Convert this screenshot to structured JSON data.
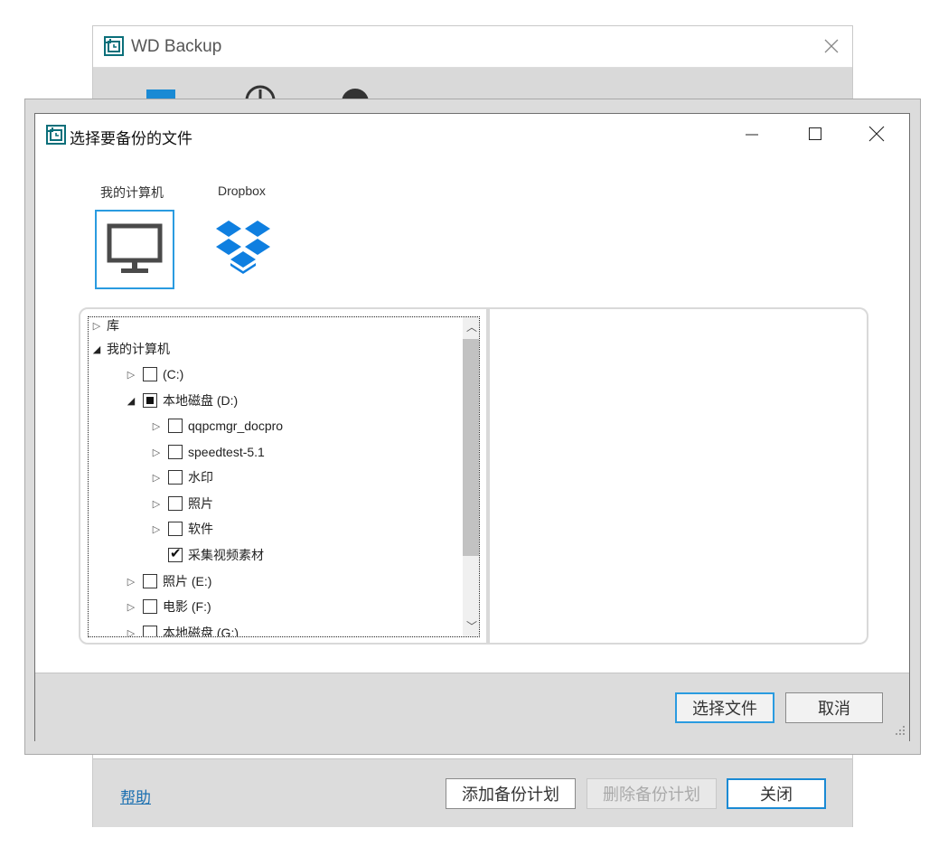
{
  "main_window": {
    "title": "WD Backup",
    "footer": {
      "help": "帮助",
      "add_plan": "添加备份计划",
      "delete_plan": "删除备份计划",
      "close": "关闭"
    }
  },
  "dialog": {
    "title": "选择要备份的文件",
    "sources": [
      {
        "label": "我的计算机",
        "icon": "monitor-icon",
        "selected": true
      },
      {
        "label": "Dropbox",
        "icon": "dropbox-icon",
        "selected": false
      }
    ],
    "tree": [
      {
        "label": "库",
        "expander": "collapsed",
        "checkbox": "none"
      },
      {
        "label": "我的计算机",
        "expander": "expanded",
        "checkbox": "none"
      },
      {
        "label": "(C:)",
        "expander": "collapsed",
        "checkbox": "unchecked"
      },
      {
        "label": "本地磁盘 (D:)",
        "expander": "expanded",
        "checkbox": "partial"
      },
      {
        "label": "qqpcmgr_docpro",
        "expander": "collapsed",
        "checkbox": "unchecked"
      },
      {
        "label": "speedtest-5.1",
        "expander": "collapsed",
        "checkbox": "unchecked"
      },
      {
        "label": "水印",
        "expander": "collapsed",
        "checkbox": "unchecked"
      },
      {
        "label": "照片",
        "expander": "collapsed",
        "checkbox": "unchecked"
      },
      {
        "label": "软件",
        "expander": "collapsed",
        "checkbox": "unchecked"
      },
      {
        "label": "采集视频素材",
        "expander": "none",
        "checkbox": "checked"
      },
      {
        "label": "照片 (E:)",
        "expander": "collapsed",
        "checkbox": "unchecked"
      },
      {
        "label": "电影 (F:)",
        "expander": "collapsed",
        "checkbox": "unchecked"
      },
      {
        "label": "本地磁盘 (G:)",
        "expander": "collapsed",
        "checkbox": "unchecked"
      }
    ],
    "buttons": {
      "select": "选择文件",
      "cancel": "取消"
    }
  },
  "colors": {
    "accent": "#2a9be0",
    "dropbox": "#0f7fe0",
    "chrome": "#dcdcdc"
  }
}
